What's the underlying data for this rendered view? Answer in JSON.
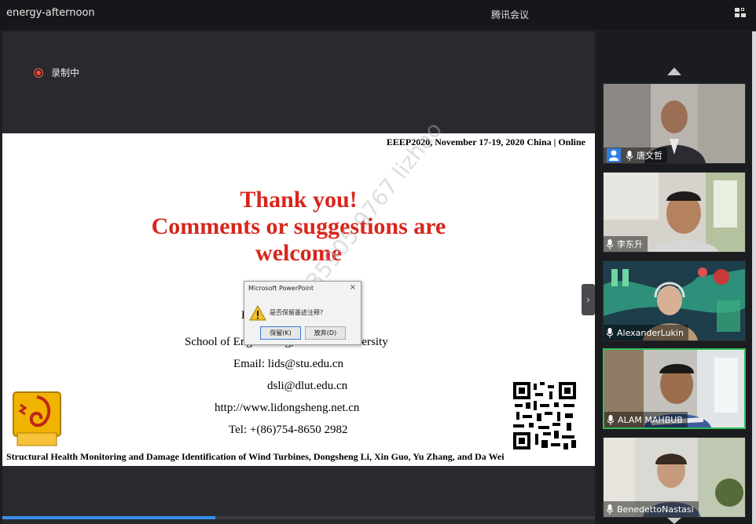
{
  "window": {
    "meeting_name": "energy-afternoon",
    "app_name": "腾讯会议"
  },
  "recording": {
    "label": "录制中"
  },
  "slide": {
    "header": "EEEP2020, November 17-19, 2020 China | Online",
    "title_lines": [
      "Thank you!",
      "Comments or suggestions are",
      "welcome"
    ],
    "author_line": "D",
    "affiliation": "School of Engineering, Shantou University",
    "email1": "Email: lids@stu.edu.cn",
    "email2": "dsli@dlut.edu.cn",
    "website": "http://www.lidongsheng.net.cn",
    "tel": "Tel: +(86)754-8650 2982",
    "footer": "Structural Health Monitoring and Damage Identification of Wind Turbines, Dongsheng Li, Xin Guo, Yu Zhang, and Da Wei",
    "logo_text": "汕大",
    "watermark": "13435905 9767 lizhao"
  },
  "dialog": {
    "title": "Microsoft PowerPoint",
    "message": "是否保留墨迹注释?",
    "keep_button": "保留(K)",
    "discard_button": "放弃(D)"
  },
  "participants": [
    {
      "name": "唐文哲",
      "is_host": true,
      "active": false
    },
    {
      "name": "李东升",
      "is_host": false,
      "active": false
    },
    {
      "name": "AlexanderLukin",
      "is_host": false,
      "active": false
    },
    {
      "name": "ALAM MAHBUB",
      "is_host": false,
      "active": true
    },
    {
      "name": "BenedettoNastasi",
      "is_host": false,
      "active": false
    }
  ],
  "progress": {
    "fraction": 0.36
  },
  "colors": {
    "accent": "#3a8ff0",
    "title_red": "#d8261c",
    "active_border": "#2fbf5a",
    "record_red": "#ff4a3a"
  }
}
